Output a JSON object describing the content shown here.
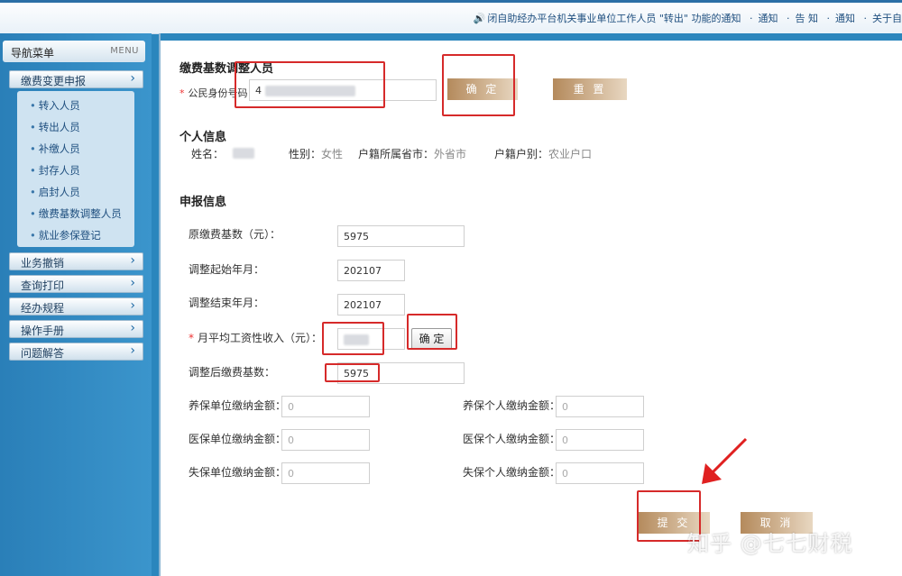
{
  "header": {
    "notice": "闭自助经办平台机关事业单位工作人员 \"转出\" 功能的通知",
    "links": [
      "通知",
      "告 知",
      "通知",
      "关于自"
    ]
  },
  "sidebar": {
    "title": "导航菜单",
    "menu_label": "MENU",
    "groups": [
      "缴费变更申报",
      "业务撤销",
      "查询打印",
      "经办规程",
      "操作手册",
      "问题解答"
    ],
    "sub_items": [
      "转入人员",
      "转出人员",
      "补缴人员",
      "封存人员",
      "启封人员",
      "缴费基数调整人员",
      "就业参保登记"
    ]
  },
  "search": {
    "title": "缴费基数调整人员",
    "id_label": "公民身份号码：",
    "id_value": "4",
    "confirm": "确 定",
    "reset": "重 置"
  },
  "personal": {
    "title": "个人信息",
    "name_label": "姓名：",
    "gender_label": "性别：",
    "gender": "女性",
    "province_label": "户籍所属省市：",
    "province": "外省市",
    "hukou_label": "户籍户别：",
    "hukou": "农业户口"
  },
  "declare": {
    "title": "申报信息",
    "orig_base_label": "原缴费基数（元）：",
    "orig_base": "5975",
    "start_label": "调整起始年月：",
    "start": "202107",
    "end_label": "调整结束年月：",
    "end": "202107",
    "income_label": "月平均工资性收入（元）：",
    "income_confirm": "确 定",
    "adjusted_label": "调整后缴费基数：",
    "adjusted": "5975",
    "pension_unit_label": "养保单位缴纳金额：",
    "pension_unit": "0",
    "pension_personal_label": "养保个人缴纳金额：",
    "pension_personal": "0",
    "medical_unit_label": "医保单位缴纳金额：",
    "medical_unit": "0",
    "medical_personal_label": "医保个人缴纳金额：",
    "medical_personal": "0",
    "unemp_unit_label": "失保单位缴纳金额：",
    "unemp_unit": "0",
    "unemp_personal_label": "失保个人缴纳金额：",
    "unemp_personal": "0",
    "submit": "提 交",
    "cancel": "取 消"
  },
  "watermark": "知乎 @七七财税"
}
